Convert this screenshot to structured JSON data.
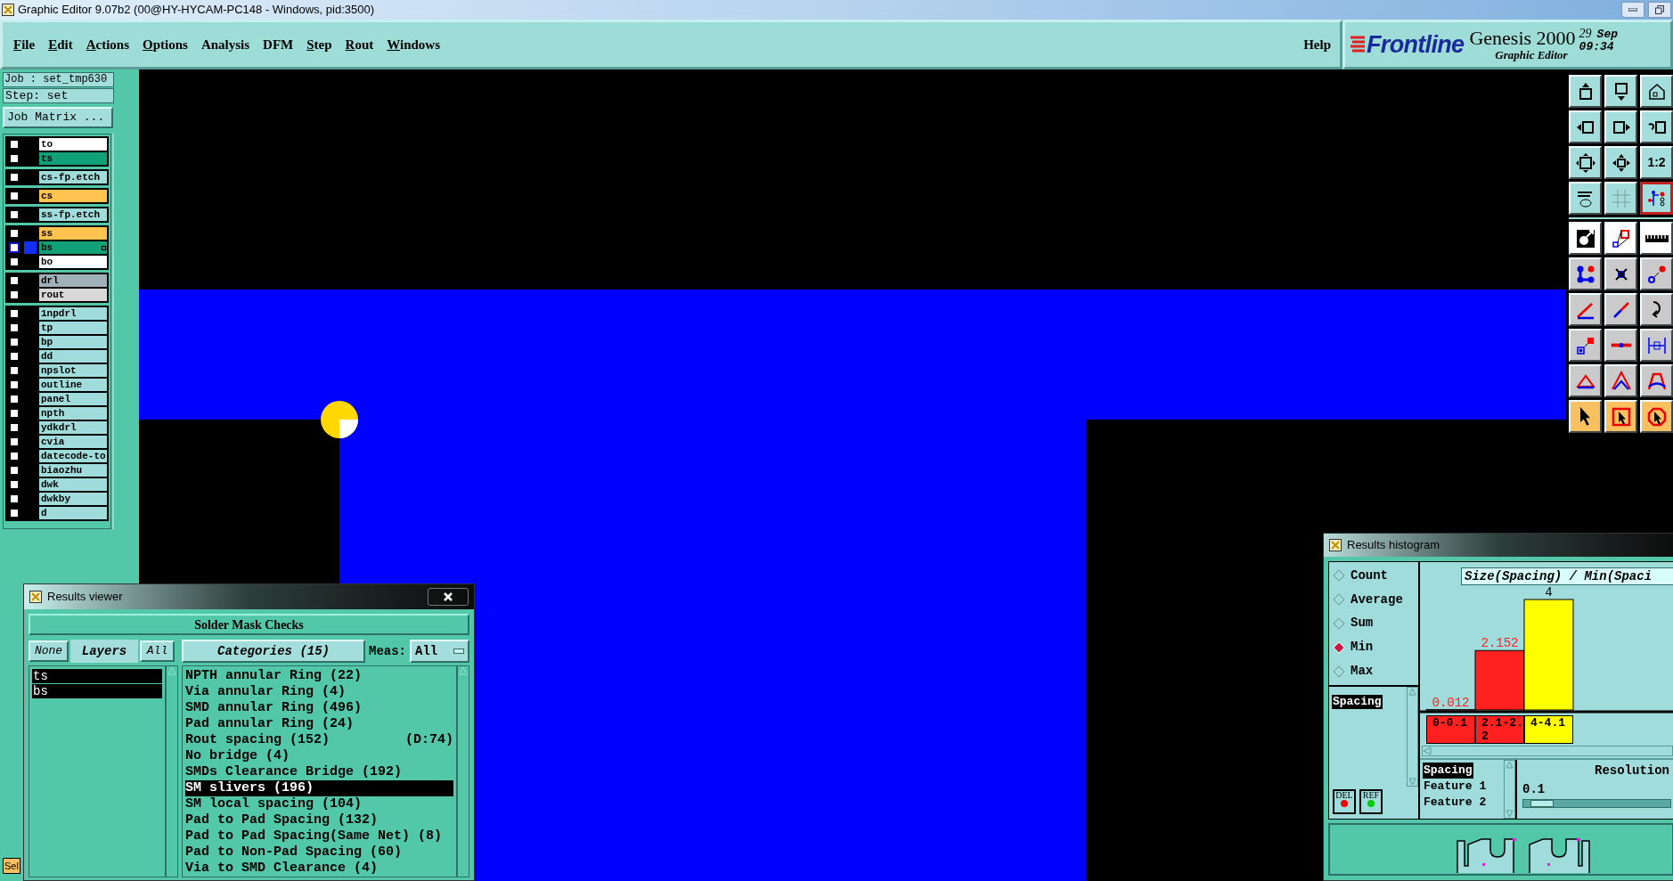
{
  "window": {
    "title": "Graphic Editor 9.07b2 (00@HY-HYCAM-PC148 - Windows, pid:3500)"
  },
  "menu": [
    {
      "label": "File",
      "mnemonic": true
    },
    {
      "label": "Edit",
      "mnemonic": true
    },
    {
      "label": "Actions",
      "mnemonic": true
    },
    {
      "label": "Options",
      "mnemonic": true
    },
    {
      "label": "Analysis",
      "mnemonic": false
    },
    {
      "label": "DFM",
      "mnemonic": false
    },
    {
      "label": "Step",
      "mnemonic": true
    },
    {
      "label": "Rout",
      "mnemonic": true
    },
    {
      "label": "Windows",
      "mnemonic": true
    }
  ],
  "help": "Help",
  "brand": {
    "logo": "Frontline",
    "product": "Genesis 2000",
    "subtitle": "Graphic Editor",
    "day": "29",
    "month": "Sep",
    "time": "09:34"
  },
  "job": {
    "job": "Job : set_tmp630",
    "step": "Step: set",
    "matrix_button": "Job Matrix ..."
  },
  "layer_groups": [
    {
      "layers": [
        {
          "name": "to",
          "color": "#ffffff",
          "checked": false,
          "selected": false
        },
        {
          "name": "ts",
          "color": "#12a078",
          "checked": false,
          "selected": false
        }
      ]
    },
    {
      "layers": [
        {
          "name": "cs-fp.etch",
          "color": "#a0dcdc",
          "checked": false,
          "selected": false
        }
      ]
    },
    {
      "layers": [
        {
          "name": "cs",
          "color": "#ffc450",
          "checked": false,
          "selected": false
        }
      ]
    },
    {
      "layers": [
        {
          "name": "ss-fp.etch",
          "color": "#a0dcdc",
          "checked": false,
          "selected": false
        }
      ]
    },
    {
      "layers": [
        {
          "name": "ss",
          "color": "#ffc450",
          "checked": false,
          "selected": false
        },
        {
          "name": "bs",
          "color": "#12a078",
          "checked": false,
          "selected": true
        },
        {
          "name": "bo",
          "color": "#ffffff",
          "checked": false,
          "selected": false
        }
      ]
    },
    {
      "layers": [
        {
          "name": "drl",
          "color": "#a0b0b8",
          "checked": false,
          "selected": false
        },
        {
          "name": "rout",
          "color": "#d8d8d8",
          "checked": false,
          "selected": false
        }
      ]
    },
    {
      "layers": [
        {
          "name": "1npdrl",
          "color": "#a0dcdc",
          "checked": false,
          "selected": false
        },
        {
          "name": "tp",
          "color": "#a0dcdc",
          "checked": false,
          "selected": false
        },
        {
          "name": "bp",
          "color": "#a0dcdc",
          "checked": false,
          "selected": false
        },
        {
          "name": "dd",
          "color": "#a0dcdc",
          "checked": false,
          "selected": false
        },
        {
          "name": "npslot",
          "color": "#a0dcdc",
          "checked": false,
          "selected": false
        },
        {
          "name": "outline",
          "color": "#a0dcdc",
          "checked": false,
          "selected": false
        },
        {
          "name": "panel",
          "color": "#a0dcdc",
          "checked": false,
          "selected": false
        },
        {
          "name": "npth",
          "color": "#a0dcdc",
          "checked": false,
          "selected": false
        },
        {
          "name": "ydkdrl",
          "color": "#a0dcdc",
          "checked": false,
          "selected": false
        },
        {
          "name": "cvia",
          "color": "#a0dcdc",
          "checked": false,
          "selected": false
        },
        {
          "name": "datecode-to",
          "color": "#a0dcdc",
          "checked": false,
          "selected": false
        },
        {
          "name": "biaozhu",
          "color": "#a0dcdc",
          "checked": false,
          "selected": false
        },
        {
          "name": "dwk",
          "color": "#a0dcdc",
          "checked": false,
          "selected": false
        },
        {
          "name": "dwkby",
          "color": "#a0dcdc",
          "checked": false,
          "selected": false
        },
        {
          "name": "d",
          "color": "#a0dcdc",
          "checked": false,
          "selected": false
        }
      ]
    }
  ],
  "toolbar": [
    {
      "kind": "view",
      "selected": false
    },
    {
      "kind": "view",
      "selected": false
    },
    {
      "kind": "view",
      "selected": false
    },
    {
      "kind": "view",
      "selected": false
    },
    {
      "kind": "view",
      "selected": false
    },
    {
      "kind": "view",
      "selected": false
    },
    {
      "kind": "view",
      "selected": false
    },
    {
      "kind": "view",
      "selected": false
    },
    {
      "kind": "view",
      "selected": false,
      "label": "1:2"
    },
    {
      "kind": "view",
      "selected": false
    },
    {
      "kind": "view",
      "selected": false
    },
    {
      "kind": "view",
      "selected": true
    },
    {
      "kind": "measure",
      "selected": false
    },
    {
      "kind": "measure",
      "selected": false
    },
    {
      "kind": "measure",
      "selected": false
    },
    {
      "kind": "edit",
      "selected": false
    },
    {
      "kind": "edit",
      "selected": false
    },
    {
      "kind": "edit",
      "selected": false
    },
    {
      "kind": "edit",
      "selected": false
    },
    {
      "kind": "edit",
      "selected": false
    },
    {
      "kind": "edit",
      "selected": false
    },
    {
      "kind": "edit",
      "selected": false
    },
    {
      "kind": "edit",
      "selected": false
    },
    {
      "kind": "edit",
      "selected": false
    },
    {
      "kind": "edit",
      "selected": false
    },
    {
      "kind": "edit",
      "selected": false
    },
    {
      "kind": "edit",
      "selected": false
    },
    {
      "kind": "select",
      "selected": false
    },
    {
      "kind": "select",
      "selected": false
    },
    {
      "kind": "select",
      "selected": false
    }
  ],
  "sel_tab": "Sel",
  "results_viewer": {
    "title": "Results viewer",
    "heading": "Solder Mask Checks",
    "none_button": "None",
    "layers_label": "Layers",
    "all_button": "All",
    "layers": [
      {
        "name": "ts",
        "selected": true
      },
      {
        "name": "bs",
        "selected": true
      }
    ],
    "categories_label": "Categories (15)",
    "meas_label": "Meas:",
    "meas_value": "All",
    "categories": [
      {
        "name": "NPTH annular Ring (22)",
        "selected": false
      },
      {
        "name": "Via annular Ring (4)",
        "selected": false
      },
      {
        "name": "SMD annular Ring (496)",
        "selected": false
      },
      {
        "name": "Pad annular Ring (24)",
        "selected": false
      },
      {
        "name": "Rout spacing (152)",
        "note": "(D:74)",
        "selected": false
      },
      {
        "name": "No bridge (4)",
        "selected": false
      },
      {
        "name": "SMDs Clearance Bridge (192)",
        "selected": false
      },
      {
        "name": "SM slivers (196)",
        "selected": true
      },
      {
        "name": "SM local spacing (104)",
        "selected": false
      },
      {
        "name": "Pad to Pad Spacing (132)",
        "selected": false
      },
      {
        "name": "Pad to Pad Spacing(Same Net) (8)",
        "selected": false
      },
      {
        "name": "Pad to Non-Pad Spacing (60)",
        "selected": false
      },
      {
        "name": "Via to SMD Clearance (4)",
        "selected": false
      }
    ]
  },
  "histogram": {
    "title": "Results histogram",
    "modes": [
      {
        "label": "Count",
        "selected": false
      },
      {
        "label": "Average",
        "selected": false
      },
      {
        "label": "Sum",
        "selected": false
      },
      {
        "label": "Min",
        "selected": true
      },
      {
        "label": "Max",
        "selected": false
      }
    ],
    "lists": [
      {
        "name": "Spacing",
        "selected": true
      }
    ],
    "del_button": "DEL",
    "ref_button": "REF",
    "chart_data": {
      "type": "bar",
      "title": "Size(Spacing) / Min(Spaci",
      "categories": [
        "0-0.1",
        "2.1-2.2",
        "4-4.1"
      ],
      "values": [
        0.012,
        2.152,
        4
      ],
      "data_labels": true
    },
    "bins": [
      {
        "color": "#ff2020"
      },
      {
        "color": "#ff2020"
      },
      {
        "color": "#ffff00"
      }
    ],
    "fields": [
      {
        "name": "Spacing",
        "selected": true
      },
      {
        "name": "Feature 1",
        "selected": false
      },
      {
        "name": "Feature 2",
        "selected": false
      }
    ],
    "resolution_label": "Resolution",
    "resolution_value": "0.1",
    "resolution_slider": {
      "level": 0.05
    }
  }
}
